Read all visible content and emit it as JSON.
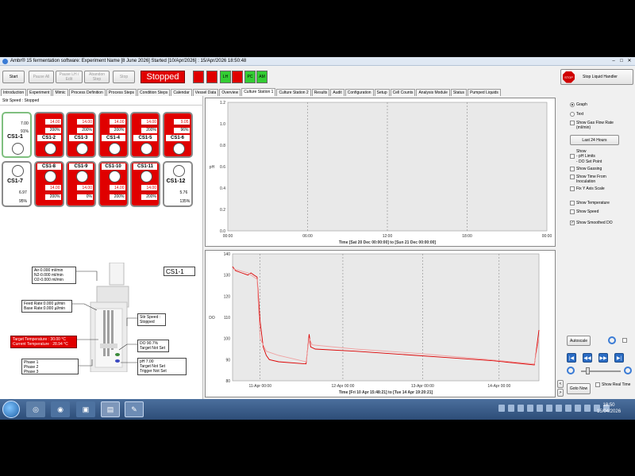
{
  "window": {
    "title": "Ambr® 15 fermentation software: Experiment Name [8 June 2026] Started [10/Apr/2026] : 15/Apr/2026 18:50:48"
  },
  "toolbar": {
    "start": "Start",
    "pause_all": "Pause All",
    "pause_lh": "Pause LH / Edit",
    "abandon": "Abandon Step",
    "stop": "Stop",
    "status": "Stopped",
    "pills": [
      "",
      "",
      "LH",
      "",
      "PC",
      "AM"
    ],
    "stop_handler": "Stop Liquid Handler",
    "stop_icon_text": "STOP"
  },
  "tabs": [
    "Introduction",
    "Experiment",
    "Mimic",
    "Process Definition",
    "Process Steps",
    "Condition Steps",
    "Calendar",
    "Vessel Data",
    "Overview",
    "Culture Station 1",
    "Culture Station 2",
    "Results",
    "Audit",
    "Configuration",
    "Setup",
    "Cell Counts",
    "Analysis Module",
    "Status",
    "Pumped Liquids"
  ],
  "active_tab": "Culture Station 1",
  "left": {
    "stir_speed": "Stir Speed : Stopped",
    "vessels_top": [
      {
        "label": "CS1-1",
        "ph": "7.00",
        "do": "91%",
        "style": "sel"
      },
      {
        "label": "CS1-2",
        "ph": "14.00",
        "do": "200%",
        "style": "red"
      },
      {
        "label": "CS1-3",
        "ph": "14.00",
        "do": "200%",
        "style": "red"
      },
      {
        "label": "CS1-4",
        "ph": "14.00",
        "do": "200%",
        "style": "red"
      },
      {
        "label": "CS1-5",
        "ph": "14.00",
        "do": "200%",
        "style": "red"
      },
      {
        "label": "CS1-6",
        "ph": "9.05",
        "do": "96%",
        "style": "red"
      }
    ],
    "vessels_bottom": [
      {
        "label": "CS1-7",
        "ph": "6.97",
        "do": "95%",
        "style": "white"
      },
      {
        "label": "CS1-8",
        "ph": "14.00",
        "do": "200%",
        "style": "red"
      },
      {
        "label": "CS1-9",
        "ph": "14.00",
        "do": "0%",
        "style": "red"
      },
      {
        "label": "CS1-10",
        "ph": "14.00",
        "do": "200%",
        "style": "red"
      },
      {
        "label": "CS1-11",
        "ph": "14.00",
        "do": "200%",
        "style": "red"
      },
      {
        "label": "CS1-12",
        "ph": "5.76",
        "do": "135%",
        "style": "white"
      }
    ],
    "selected_vessel": "CS1-1",
    "gas": [
      "Air-0.000 ml/min",
      "N2-0.000 ml/min",
      "O2-0.000 ml/min"
    ],
    "feed": [
      "Feed Rate:0.000 µl/min",
      "Base Rate:0.000 µl/min"
    ],
    "temperature": [
      "Target Temperature : 30.00 °C",
      "Current Temperature : 28.94 °C"
    ],
    "phases": [
      "Phase 1",
      "Phase 2",
      "Phase 3"
    ],
    "stir_box": [
      "Stir Speed :",
      "Stopped"
    ],
    "do_box": [
      "DO 90.7%",
      "Target Not Set"
    ],
    "ph_box": [
      "pH 7.00",
      "Target Not Set",
      "Trigger Not Set"
    ]
  },
  "chart_data": [
    {
      "type": "line",
      "ylabel": "pH",
      "xlabel": "Time [Sat 20 Dec 00:00:00] to [Sun 21 Dec 00:00:00]",
      "ylim": [
        0,
        1.2
      ],
      "yticks": [
        "1.2",
        "1.0",
        "0.8",
        "0.6",
        "0.4",
        "0.2",
        "0.0"
      ],
      "xticks": [
        "00:00",
        "06:00",
        "12:00",
        "18:00",
        "00:00"
      ],
      "series": [],
      "grid": "vertical dashed"
    },
    {
      "type": "line",
      "ylabel": "DO",
      "xlabel": "Time [Fri 10 Apr 15:48:21] to [Tue 14 Apr 19:20:21]",
      "ylim": [
        80,
        140
      ],
      "yticks": [
        "140",
        "130",
        "120",
        "110",
        "100",
        "90",
        "80"
      ],
      "xticks": [
        "11-Apr 00:00",
        "12-Apr 00:00",
        "13-Apr 00:00",
        "14-Apr 00:00"
      ],
      "grid": "vertical dashed",
      "series": [
        {
          "color": "#dd0000",
          "points": [
            [
              0.0,
              134
            ],
            [
              0.01,
              132
            ],
            [
              0.03,
              131
            ],
            [
              0.05,
              130
            ],
            [
              0.06,
              131
            ],
            [
              0.07,
              130
            ],
            [
              0.08,
              129
            ],
            [
              0.09,
              108
            ],
            [
              0.1,
              96
            ],
            [
              0.11,
              92
            ],
            [
              0.12,
              90
            ],
            [
              0.15,
              89
            ],
            [
              0.24,
              88
            ],
            [
              0.25,
              102
            ],
            [
              0.255,
              96
            ],
            [
              0.27,
              95
            ],
            [
              0.4,
              94
            ],
            [
              0.55,
              92.5
            ],
            [
              0.7,
              91
            ],
            [
              0.85,
              89.5
            ],
            [
              0.985,
              87.5
            ],
            [
              0.992,
              95
            ],
            [
              1.0,
              104
            ]
          ]
        },
        {
          "color": "#f0a0a0",
          "points": [
            [
              0.0,
              133
            ],
            [
              0.05,
              131
            ],
            [
              0.08,
              128
            ],
            [
              0.09,
              100
            ],
            [
              0.11,
              94
            ],
            [
              0.15,
              92
            ],
            [
              0.24,
              89
            ],
            [
              0.25,
              100
            ],
            [
              0.26,
              97
            ],
            [
              0.4,
              95
            ],
            [
              0.6,
              93
            ],
            [
              0.8,
              90.5
            ],
            [
              0.985,
              88
            ],
            [
              1.0,
              100
            ]
          ]
        }
      ]
    }
  ],
  "right": {
    "graph": "Graph",
    "text": "Text",
    "show_gas_flow": "Show Gas Flow Rate (ml/min)",
    "last_24": "Last 24 Hours",
    "show": "Show",
    "ph_limits": "- pH Limits",
    "do_setpoint": "- DO Set Point",
    "show_gassing": "Show Gassing",
    "show_time": "Show Time From Inoculation",
    "fix_y": "Fix Y Axis Scale",
    "show_temp": "Show Temperature",
    "show_speed": "Show Speed",
    "show_smoothed": "Show Smoothed DO",
    "autoscale": "Autoscale",
    "goto_now": "Goto Now",
    "show_real_time": "Show Real Time"
  },
  "taskbar": {
    "time": "18:50",
    "date": "15/04/2026"
  }
}
